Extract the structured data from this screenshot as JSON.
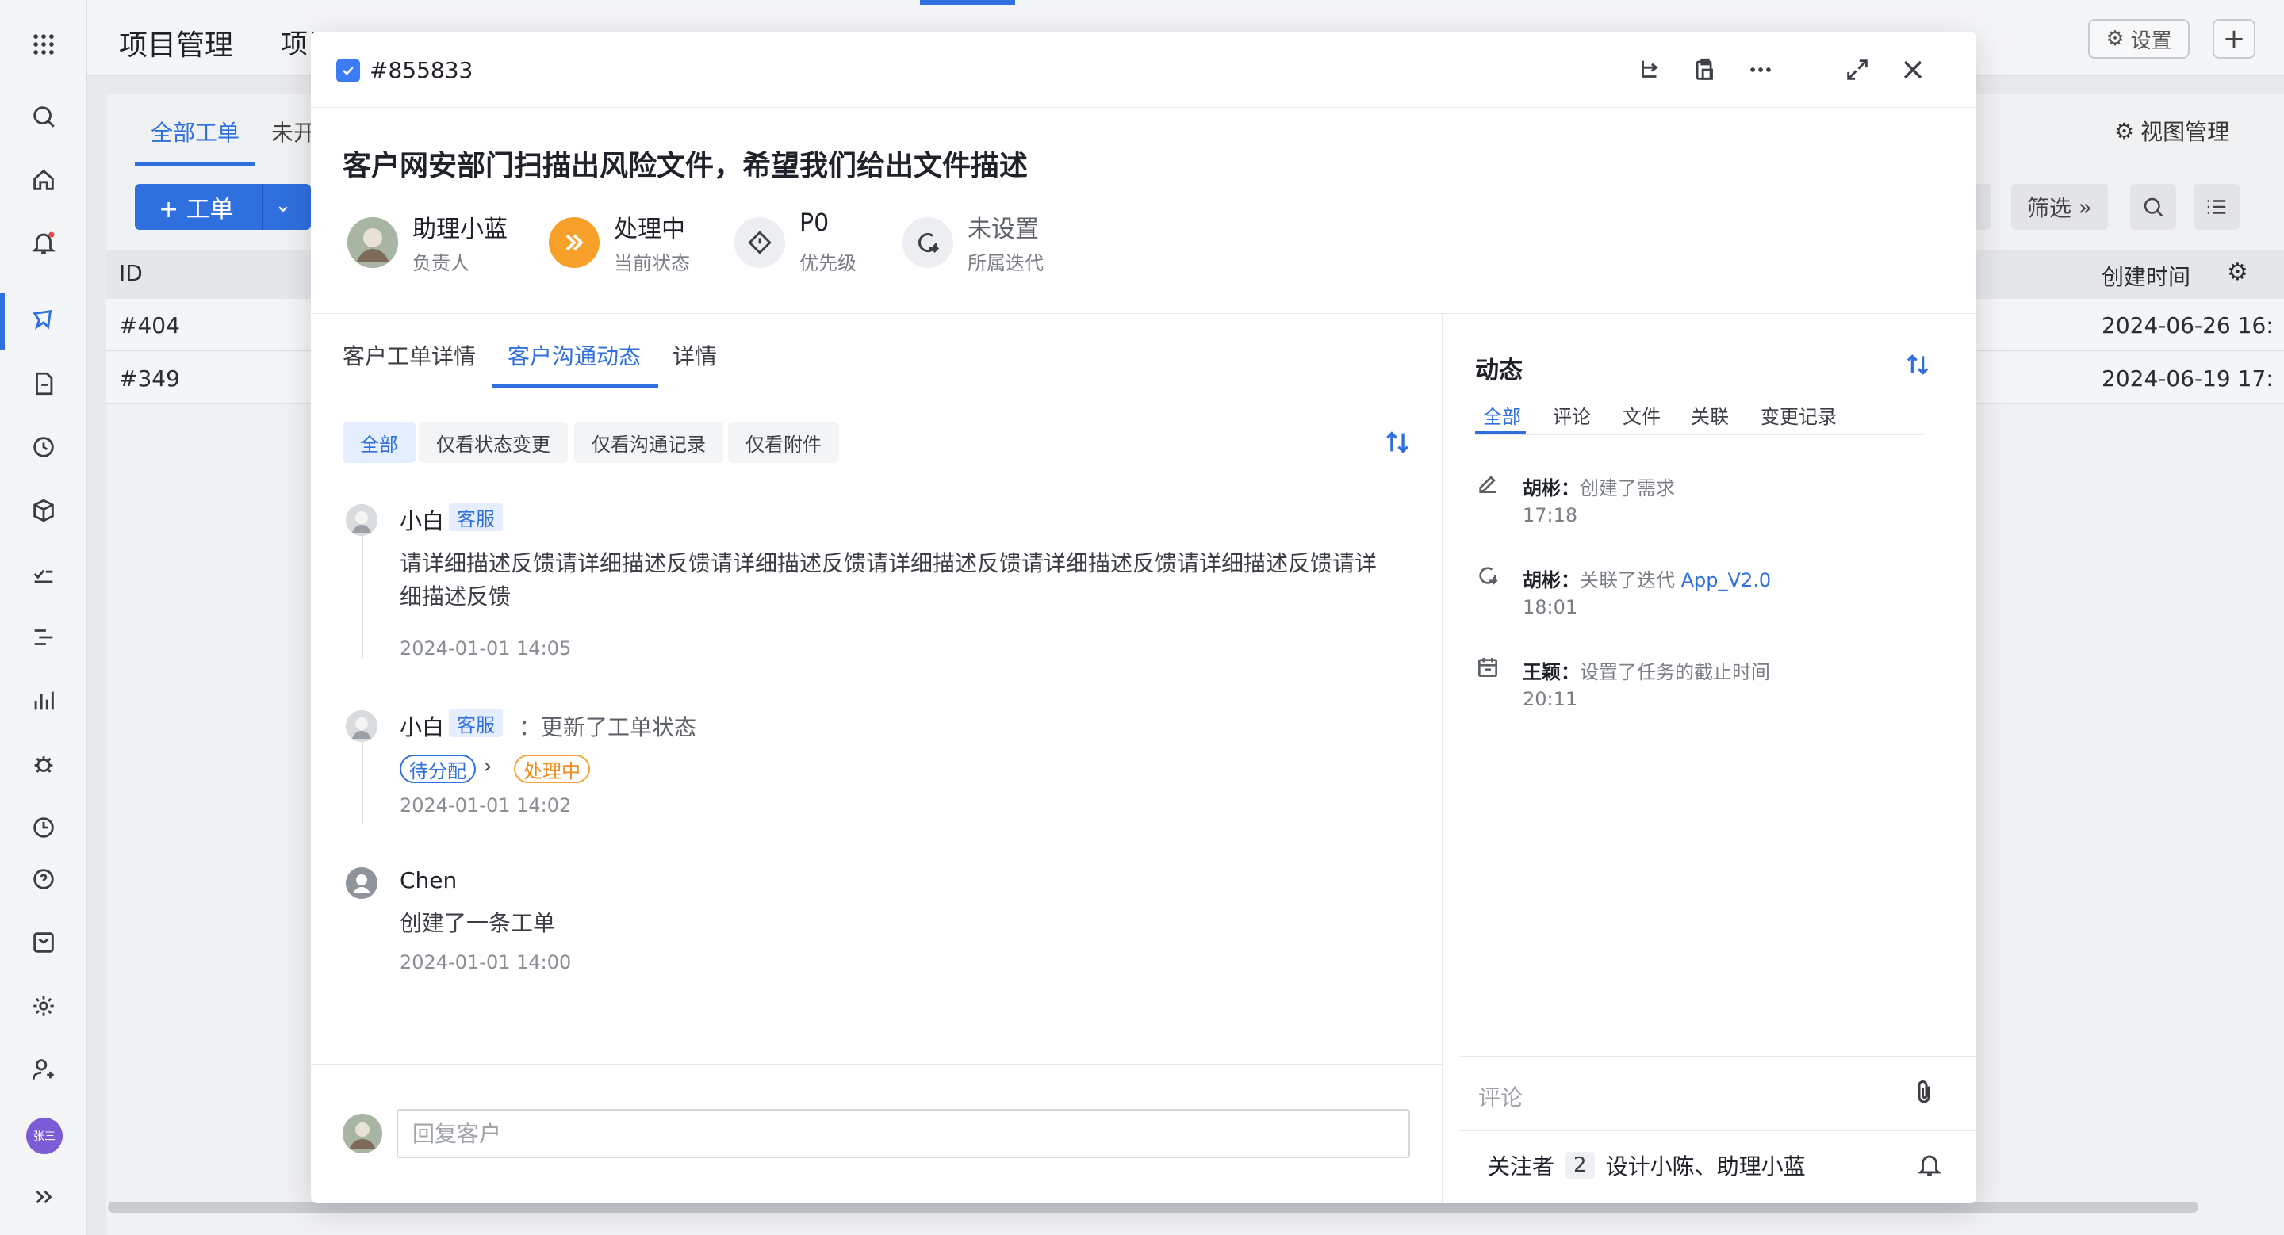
{
  "bg": {
    "project_title": "项目管理",
    "project_title2": "项目",
    "settings_label": "设置",
    "plus_label": "+",
    "tab_all": "全部工单",
    "tab_unopened": "未开",
    "view_manage": "视图管理",
    "new_button": "+ 工单",
    "filter": "筛选",
    "table": {
      "col_id": "ID",
      "col_created": "创建时间",
      "rows": [
        {
          "id": "#404",
          "created": "2024-06-26 16:"
        },
        {
          "id": "#349",
          "created": "2024-06-19 17:"
        }
      ]
    },
    "user_avatar": "张三"
  },
  "modal": {
    "ticket_id": "#855833",
    "title": "客户网安部门扫描出风险文件，希望我们给出文件描述",
    "meta": {
      "owner": {
        "value": "助理小蓝",
        "label": "负责人"
      },
      "status": {
        "value": "处理中",
        "label": "当前状态"
      },
      "priority": {
        "value": "P0",
        "label": "优先级"
      },
      "iteration": {
        "value": "未设置",
        "label": "所属迭代"
      }
    },
    "tabs": [
      "客户工单详情",
      "客户沟通动态",
      "详情"
    ],
    "filters": [
      "全部",
      "仅看状态变更",
      "仅看沟通记录",
      "仅看附件"
    ],
    "feed": [
      {
        "name": "小白",
        "role": "客服",
        "text": "请详细描述反馈请详细描述反馈请详细描述反馈请详细描述反馈请详细描述反馈请详细描述反馈请详细描述反馈",
        "time": "2024-01-01 14:05"
      },
      {
        "name": "小白",
        "role": "客服",
        "action": "：更新了工单状态",
        "from_status": "待分配",
        "to_status": "处理中",
        "time": "2024-01-01 14:02"
      },
      {
        "name": "Chen",
        "text": "创建了一条工单",
        "time": "2024-01-01 14:00"
      }
    ],
    "reply_placeholder": "回复客户",
    "activity": {
      "title": "动态",
      "tabs": [
        "全部",
        "评论",
        "文件",
        "关联",
        "变更记录"
      ],
      "items": [
        {
          "who": "胡彬：",
          "what": "创建了需求",
          "time": "17:18"
        },
        {
          "who": "胡彬：",
          "what": "关联了迭代 ",
          "link": "App_V2.0",
          "time": "18:01"
        },
        {
          "who": "王颖：",
          "what": "设置了任务的截止时间",
          "time": "20:11"
        }
      ],
      "comment_placeholder": "评论",
      "followers_label": "关注者",
      "followers_count": "2",
      "followers_names": "设计小陈、助理小蓝"
    }
  },
  "colors": {
    "accent": "#2f6fde",
    "status_orange": "#f7a12a"
  }
}
